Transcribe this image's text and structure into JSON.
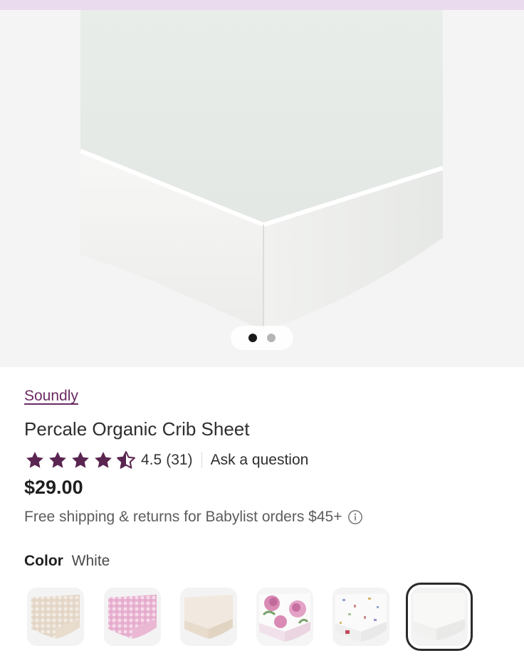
{
  "product": {
    "brand": "Soundly",
    "title": "Percale Organic Crib Sheet",
    "rating_value": "4.5",
    "rating_count": "(31)",
    "rating_stars": 4.5,
    "ask_question": "Ask a question",
    "price": "$29.00",
    "shipping": "Free shipping & returns for Babylist orders $45+"
  },
  "gallery": {
    "slide_count": 2,
    "active_slide": 1
  },
  "color": {
    "label": "Color",
    "value": "White",
    "swatches": [
      {
        "name": "beige-gingham",
        "color": "#e8dccf"
      },
      {
        "name": "pink-gingham",
        "color": "#f0c9dd"
      },
      {
        "name": "oat",
        "color": "#efe6dc"
      },
      {
        "name": "peony-floral",
        "color": "#efd8e5"
      },
      {
        "name": "terrazzo",
        "color": "#f2f2f2"
      },
      {
        "name": "white",
        "color": "#f6f6f6",
        "selected": true
      }
    ]
  },
  "colors": {
    "brand": "#6b2b62",
    "star": "#5a2551",
    "top_strip": "#eadbee"
  },
  "icons": {
    "star": "star-icon",
    "info": "info-icon"
  }
}
